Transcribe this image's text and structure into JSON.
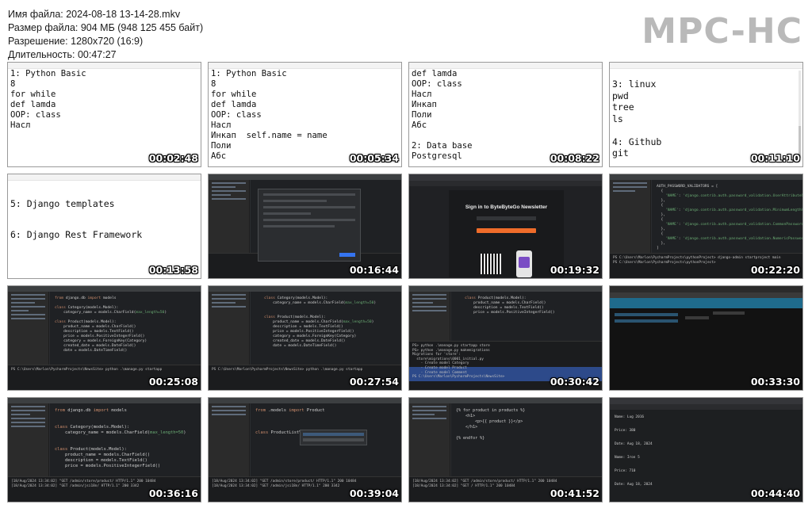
{
  "info": {
    "file_name": "Имя файла: 2024-08-18 13-14-28.mkv",
    "file_size": "Размер файла: 904 МБ (948 125 455 байт)",
    "resolution": "Разрешение: 1280x720 (16:9)",
    "duration": "Длительность: 00:47:27"
  },
  "logo": "MPC-HC",
  "thumbnails": [
    {
      "time": "00:02:48",
      "kind": "notepad",
      "text": "1: Python Basic\n8\nfor while\ndef lamda\nOOP: class\nНасл"
    },
    {
      "time": "00:05:34",
      "kind": "notepad",
      "text": "1: Python Basic\n8\nfor while\ndef lamda\nOOP: class\nНасл\nИнкап  self.name = name\nПоли\nАбс"
    },
    {
      "time": "00:08:22",
      "kind": "notepad",
      "text": "def lamda\nOOP: class\nНасл\nИнкап\nПоли\nАбс\n\n2: Data base\nPostgresql"
    },
    {
      "time": "00:11:10",
      "kind": "notepad",
      "text": "3: linux\npwd\ntree\nls\n\n4: Github\ngit"
    },
    {
      "time": "00:13:58",
      "kind": "notepad",
      "text": "5: Django templates\n\n6: Django Rest Framework"
    },
    {
      "time": "00:16:44",
      "kind": "ide-dialog"
    },
    {
      "time": "00:19:32",
      "kind": "browser-newsletter",
      "title": "Sign in to ByteByteGo Newsletter"
    },
    {
      "time": "00:22:20",
      "kind": "ide-settings"
    },
    {
      "time": "00:25:08",
      "kind": "ide-models-small"
    },
    {
      "time": "00:27:54",
      "kind": "ide-models"
    },
    {
      "time": "00:30:42",
      "kind": "ide-migrations"
    },
    {
      "time": "00:33:30",
      "kind": "browser-admin"
    },
    {
      "time": "00:36:16",
      "kind": "ide-models-large"
    },
    {
      "time": "00:39:04",
      "kind": "ide-autocomplete"
    },
    {
      "time": "00:41:52",
      "kind": "ide-template"
    },
    {
      "time": "00:44:40",
      "kind": "browser-api"
    }
  ]
}
